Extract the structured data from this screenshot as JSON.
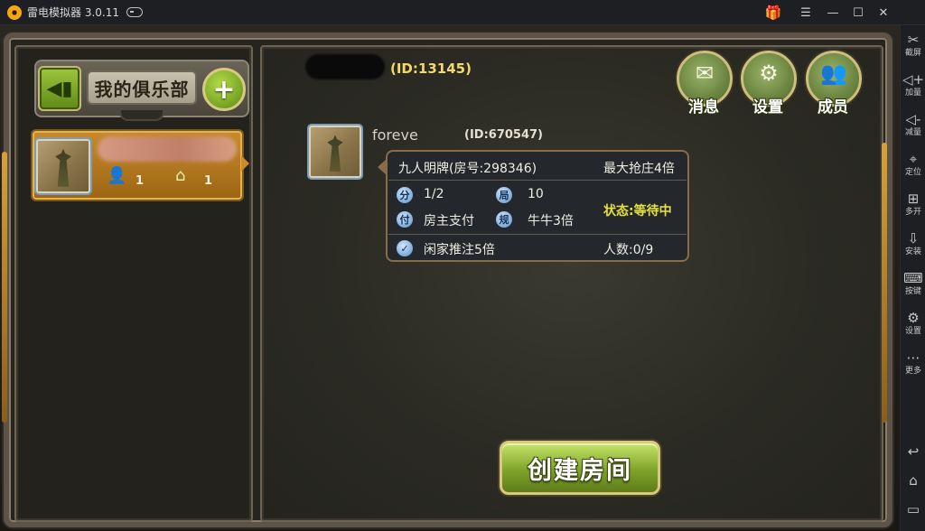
{
  "emulator": {
    "title": "雷电模拟器 3.0.11",
    "sidebar": [
      {
        "icon": "scissors-icon",
        "glyph": "✂",
        "label": "截屏"
      },
      {
        "icon": "volume-up-icon",
        "glyph": "◁+",
        "label": "加量"
      },
      {
        "icon": "volume-down-icon",
        "glyph": "◁-",
        "label": "减量"
      },
      {
        "icon": "location-icon",
        "glyph": "⌖",
        "label": "定位"
      },
      {
        "icon": "multi-open-icon",
        "glyph": "⊞",
        "label": "多开"
      },
      {
        "icon": "apk-install-icon",
        "glyph": "⇩",
        "label": "安装"
      },
      {
        "icon": "keyboard-icon",
        "glyph": "⌨",
        "label": "按键"
      },
      {
        "icon": "settings-icon",
        "glyph": "⚙",
        "label": "设置"
      },
      {
        "icon": "more-icon",
        "glyph": "⋯",
        "label": "更多"
      }
    ],
    "nav": {
      "back": "↩",
      "home": "⌂",
      "recent": "▭"
    }
  },
  "club": {
    "title": "我的俱乐部",
    "back_glyph": "◀▮",
    "add_glyph": "+",
    "item": {
      "members": "1",
      "rooms": "1"
    }
  },
  "owner": {
    "id_text": "(ID:13145)"
  },
  "top_buttons": [
    {
      "label": "消息",
      "icon": "mail-icon",
      "glyph": "✉"
    },
    {
      "label": "设置",
      "icon": "gear-icon",
      "glyph": "⚙"
    },
    {
      "label": "成员",
      "icon": "members-icon",
      "glyph": "👥"
    }
  ],
  "room": {
    "owner_name": "foreve",
    "owner_id": "(ID:670547)",
    "title": "九人明牌(房号:298346)",
    "max_banker": "最大抢庄4倍",
    "score_icon": "分",
    "score": "1/2",
    "rounds_icon": "局",
    "rounds": "10",
    "pay_icon": "付",
    "pay": "房主支付",
    "rule_icon": "规",
    "rule": "牛牛3倍",
    "status": "状态:等待中",
    "push": "闲家推注5倍",
    "players": "人数:0/9"
  },
  "create_button": "创建房间"
}
